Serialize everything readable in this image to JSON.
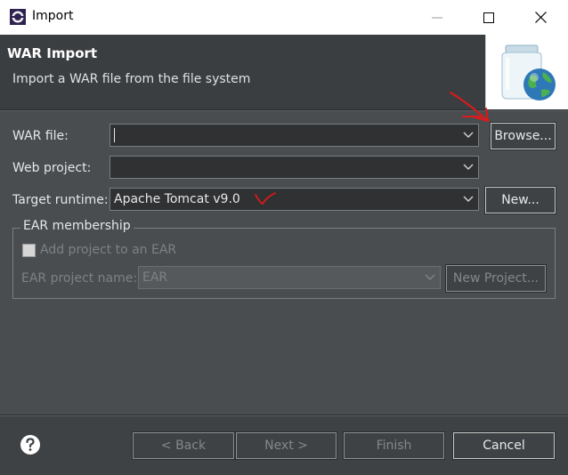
{
  "window": {
    "title": "Import",
    "minimize_icon": "minimize-icon",
    "maximize_icon": "maximize-icon",
    "close_icon": "close-icon"
  },
  "header": {
    "title": "WAR Import",
    "subtitle": "Import a WAR file from the file system",
    "image_icon": "jar-globe-icon"
  },
  "form": {
    "war_file_label": "WAR file:",
    "war_file_value": "",
    "browse_label": "Browse...",
    "web_project_label": "Web project:",
    "web_project_value": "",
    "target_runtime_label": "Target runtime:",
    "target_runtime_value": "Apache Tomcat v9.0",
    "new_label": "New..."
  },
  "ear": {
    "group_title": "EAR membership",
    "add_label": "Add project to an EAR",
    "add_checked": false,
    "project_name_label": "EAR project name:",
    "project_name_value": "EAR",
    "new_project_label": "New Project..."
  },
  "footer": {
    "help_icon": "help-icon",
    "back_label": "< Back",
    "next_label": "Next >",
    "finish_label": "Finish",
    "cancel_label": "Cancel"
  },
  "annotations": {
    "arrow_color": "#e01818",
    "checkmark_color": "#e01818"
  }
}
